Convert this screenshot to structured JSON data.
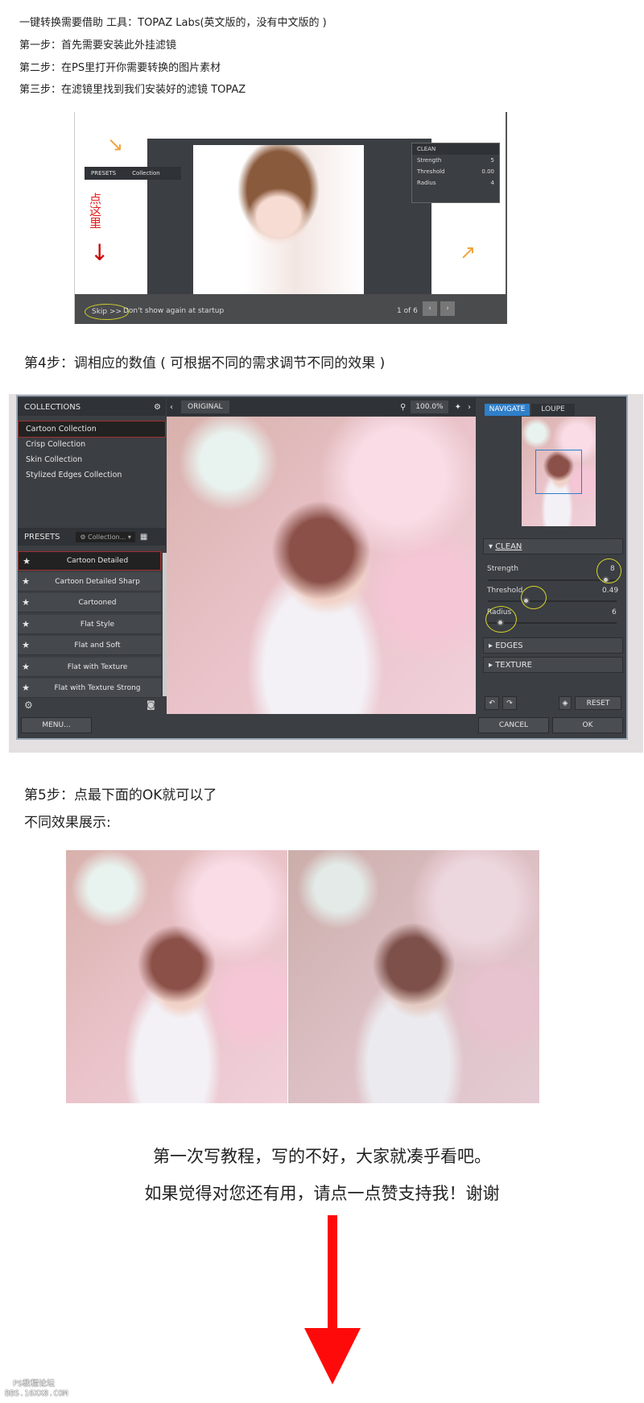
{
  "intro": {
    "line1": "一键转换需要借助  工具：TOPAZ Labs(英文版的，没有中文版的 )",
    "step1": "第一步：首先需要安装此外挂滤镜",
    "step2": "第二步：在PS里打开你需要转换的图片素材",
    "step3": "第三步：在滤镜里找到我们安装好的滤镜 TOPAZ"
  },
  "startup": {
    "click_here": "点这里",
    "presets": "PRESETS",
    "collection": "Collection",
    "clean": "CLEAN",
    "strength": "Strength",
    "threshold": "Threshold",
    "radius": "Radius",
    "strength_val": "5",
    "threshold_val": "0.00",
    "radius_val": "4",
    "skip": "Skip >>",
    "dont_show": "Don't show again at startup",
    "page": "1 of 6"
  },
  "step4": "第4步：调相应的数值 ( 可根据不同的需求调节不同的效果 )",
  "app": {
    "collections_title": "COLLECTIONS",
    "collections": [
      "Cartoon Collection",
      "Crisp Collection",
      "Skin Collection",
      "Stylized Edges Collection"
    ],
    "presets_title": "PRESETS",
    "presets_dropdown": "Collection...",
    "presets": [
      "Cartoon Detailed",
      "Cartoon Detailed Sharp",
      "Cartooned",
      "Flat Style",
      "Flat and Soft",
      "Flat with Texture",
      "Flat with Texture Strong"
    ],
    "original": "ORIGINAL",
    "zoom": "100.0%",
    "navigate": "NAVIGATE",
    "loupe": "LOUPE",
    "clean": "CLEAN",
    "edges": "EDGES",
    "texture": "TEXTURE",
    "sliders": [
      {
        "label": "Strength",
        "value": "8",
        "level": 0.92
      },
      {
        "label": "Threshold",
        "value": "0.49",
        "level": 0.3
      },
      {
        "label": "Radius",
        "value": "6",
        "level": 0.1
      }
    ],
    "reset": "RESET",
    "menu": "MENU...",
    "cancel": "CANCEL",
    "ok": "OK",
    "accent": "#2f7fc9"
  },
  "step5": "第5步：点最下面的OK就可以了",
  "results_label": "不同效果展示:",
  "closing": {
    "line1": "第一次写教程，写的不好，大家就凑乎看吧。",
    "line2": "如果觉得对您还有用，请点一点赞支持我！谢谢"
  },
  "watermark": {
    "line1": "PS教程论坛",
    "line2": "BBS.16XX8.COM"
  }
}
